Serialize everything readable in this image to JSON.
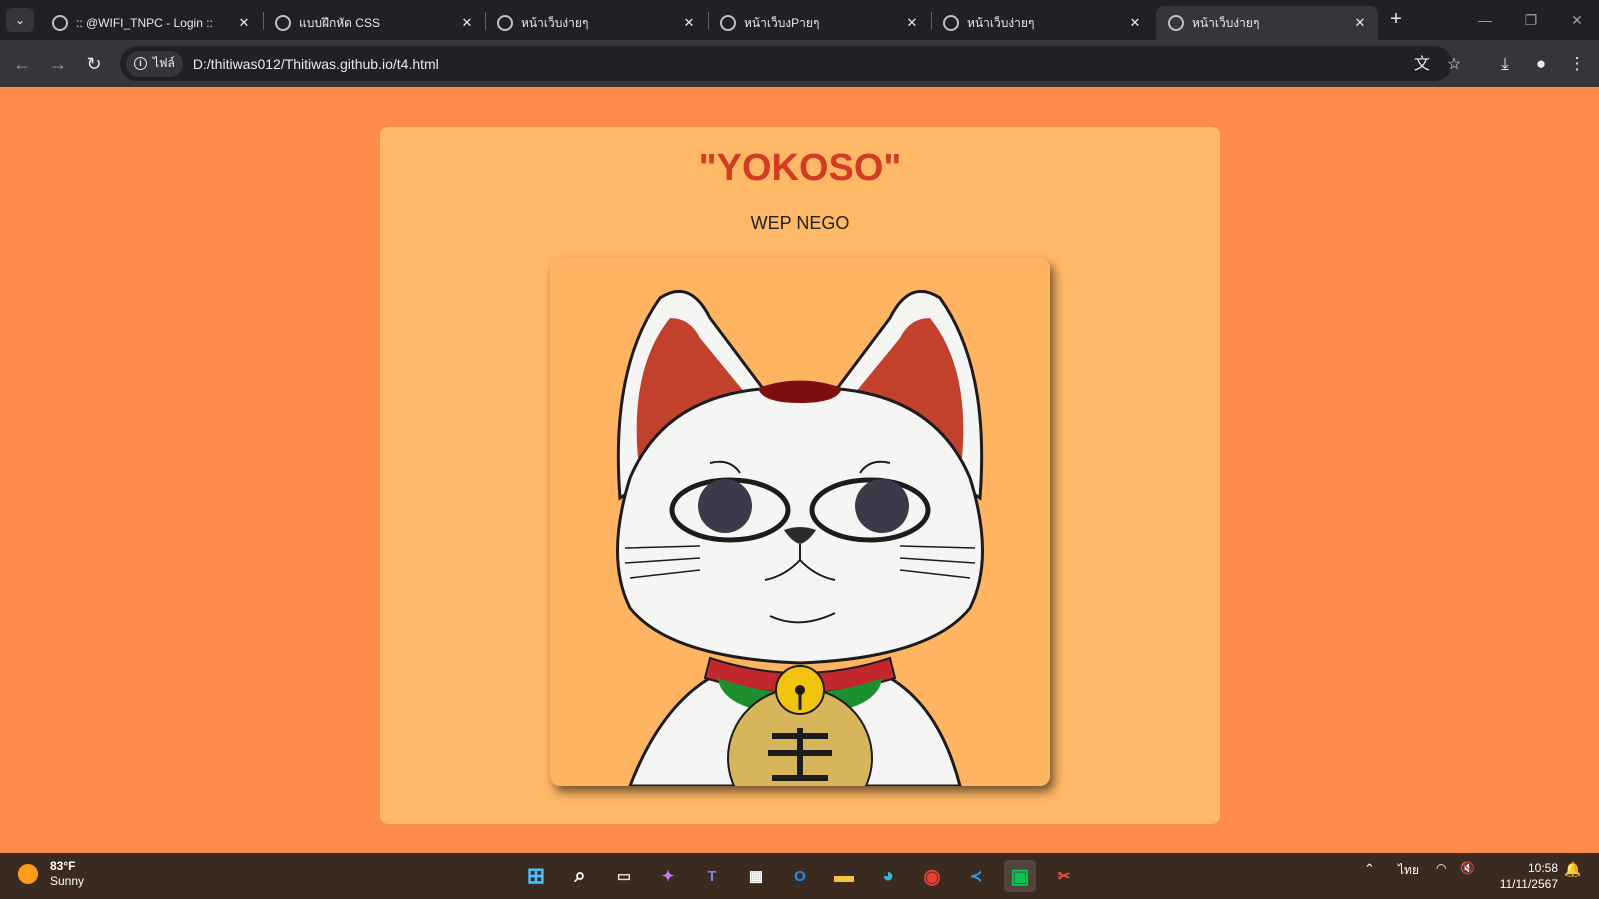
{
  "browser": {
    "tabs": [
      {
        "title": ":: @WIFI_TNPC - Login ::",
        "active": false
      },
      {
        "title": "แบบฝึกหัด CSS",
        "active": false
      },
      {
        "title": "หน้าเว็บง่ายๆ",
        "active": false
      },
      {
        "title": "หน้าเว็บงPายๆ",
        "active": false
      },
      {
        "title": "หน้าเว็บง่ายๆ",
        "active": false
      },
      {
        "title": "หน้าเว็บง่ายๆ",
        "active": true
      }
    ],
    "site_info_label": "ไฟล์",
    "url": "D:/thitiwas012/Thitiwas.github.io/t4.html"
  },
  "page": {
    "heading": "\"YOKOSO\"",
    "subheading": "WEP NEGO",
    "image_icon": "maneki-neko-cat-image",
    "colors": {
      "background": "#ff8c4a",
      "card": "#ffb866",
      "heading": "#d13c22"
    }
  },
  "taskbar": {
    "weather_temp": "83°F",
    "weather_desc": "Sunny",
    "apps": [
      "start",
      "search",
      "task-view",
      "copilot",
      "teams",
      "store",
      "outlook",
      "file-explorer",
      "edge",
      "chrome",
      "vscode",
      "line",
      "snipping-tool"
    ],
    "language": "ไทย",
    "time": "10:58",
    "date": "11/11/2567"
  }
}
